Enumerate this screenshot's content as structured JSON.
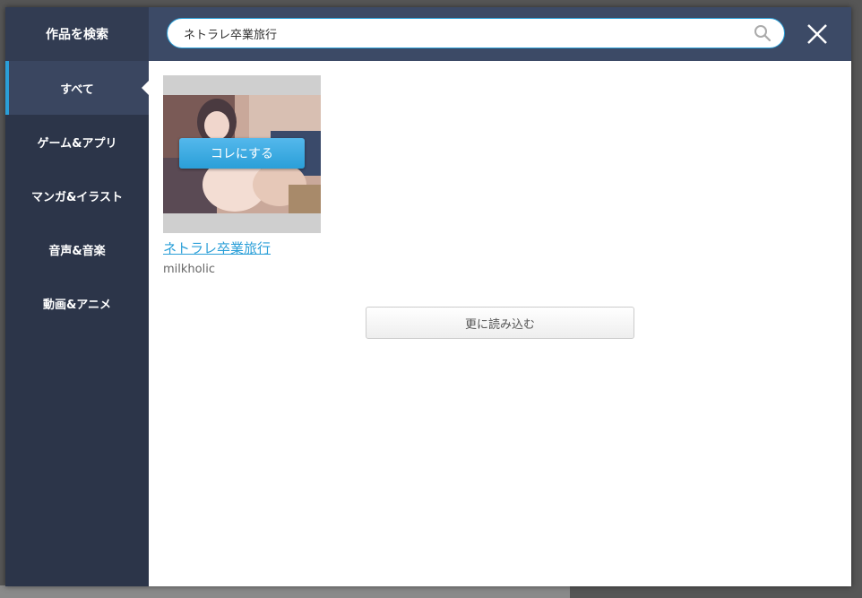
{
  "sidebar": {
    "title": "作品を検索",
    "items": [
      {
        "label": "すべて",
        "active": true
      },
      {
        "label": "ゲーム&アプリ",
        "active": false
      },
      {
        "label": "マンガ&イラスト",
        "active": false
      },
      {
        "label": "音声&音楽",
        "active": false
      },
      {
        "label": "動画&アニメ",
        "active": false
      }
    ]
  },
  "search": {
    "value": "ネトラレ卒業旅行",
    "icon": "search-icon"
  },
  "close": {
    "icon": "close-icon"
  },
  "results": [
    {
      "title": "ネトラレ卒業旅行",
      "maker": "milkholic",
      "choose_label": "コレにする"
    }
  ],
  "load_more_label": "更に読み込む",
  "colors": {
    "sidebar_bg": "#2c3549",
    "topbar_bg": "#3c4a66",
    "accent": "#2a9fd8"
  }
}
